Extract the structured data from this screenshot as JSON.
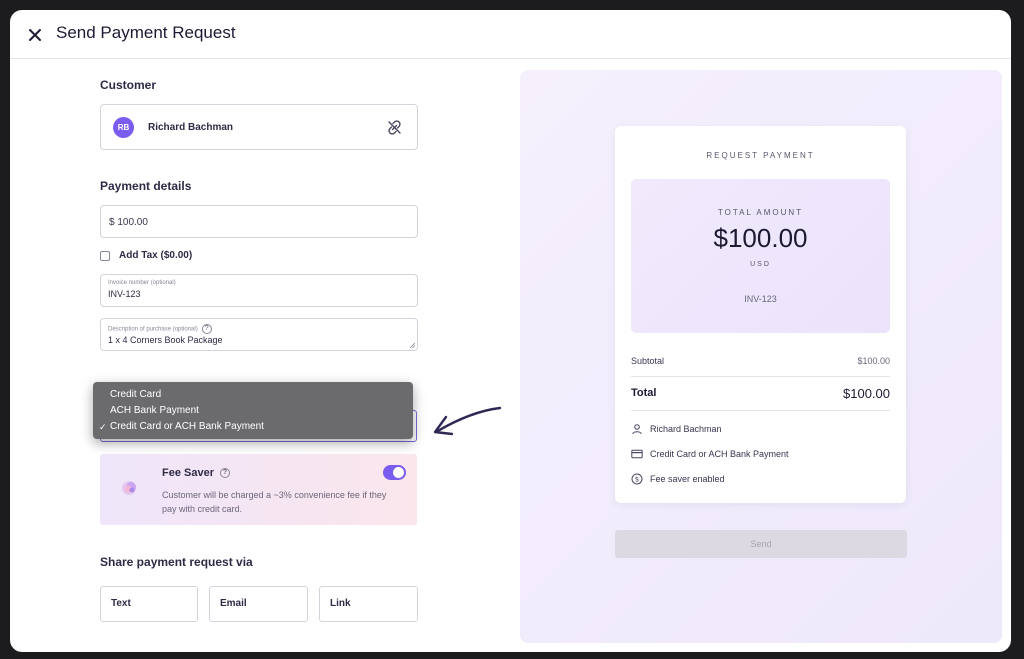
{
  "header": {
    "title": "Send Payment Request"
  },
  "customer": {
    "section_label": "Customer",
    "initials": "RB",
    "name": "Richard Bachman"
  },
  "payment": {
    "section_label": "Payment details",
    "amount_value": "$ 100.00",
    "add_tax_label": "Add Tax ($0.00)",
    "invoice_label": "Invoice number (optional)",
    "invoice_value": "INV-123",
    "description_label": "Description of purchase (optional)",
    "description_value": "1 x 4 Corners Book Package"
  },
  "payment_method": {
    "options": [
      "Credit Card",
      "ACH Bank Payment",
      "Credit Card or ACH Bank Payment"
    ],
    "selected": "Credit Card or ACH Bank Payment",
    "check_glyph": "✓"
  },
  "fee_saver": {
    "title": "Fee Saver",
    "description": "Customer will be charged a ~3% convenience fee if they pay with credit card.",
    "enabled": true
  },
  "share": {
    "section_label": "Share payment request via",
    "buttons": [
      "Text",
      "Email",
      "Link"
    ]
  },
  "preview": {
    "heading": "REQUEST PAYMENT",
    "total_amount_label": "TOTAL AMOUNT",
    "amount": "$100.00",
    "currency": "USD",
    "invoice": "INV-123",
    "subtotal_label": "Subtotal",
    "subtotal_value": "$100.00",
    "total_label": "Total",
    "total_value": "$100.00",
    "customer": "Richard Bachman",
    "method": "Credit Card or ACH Bank Payment",
    "fee_saver_status": "Fee saver enabled",
    "send_label": "Send"
  },
  "icons": [
    "close-icon",
    "unlink-icon",
    "help-icon",
    "person-icon",
    "credit-card-icon",
    "dollar-circle-icon",
    "arrow-annotation-icon"
  ],
  "colors": {
    "accent": "#7b5cf0",
    "panel_bg": "#f3effc",
    "text_dark": "#1e1a33"
  }
}
